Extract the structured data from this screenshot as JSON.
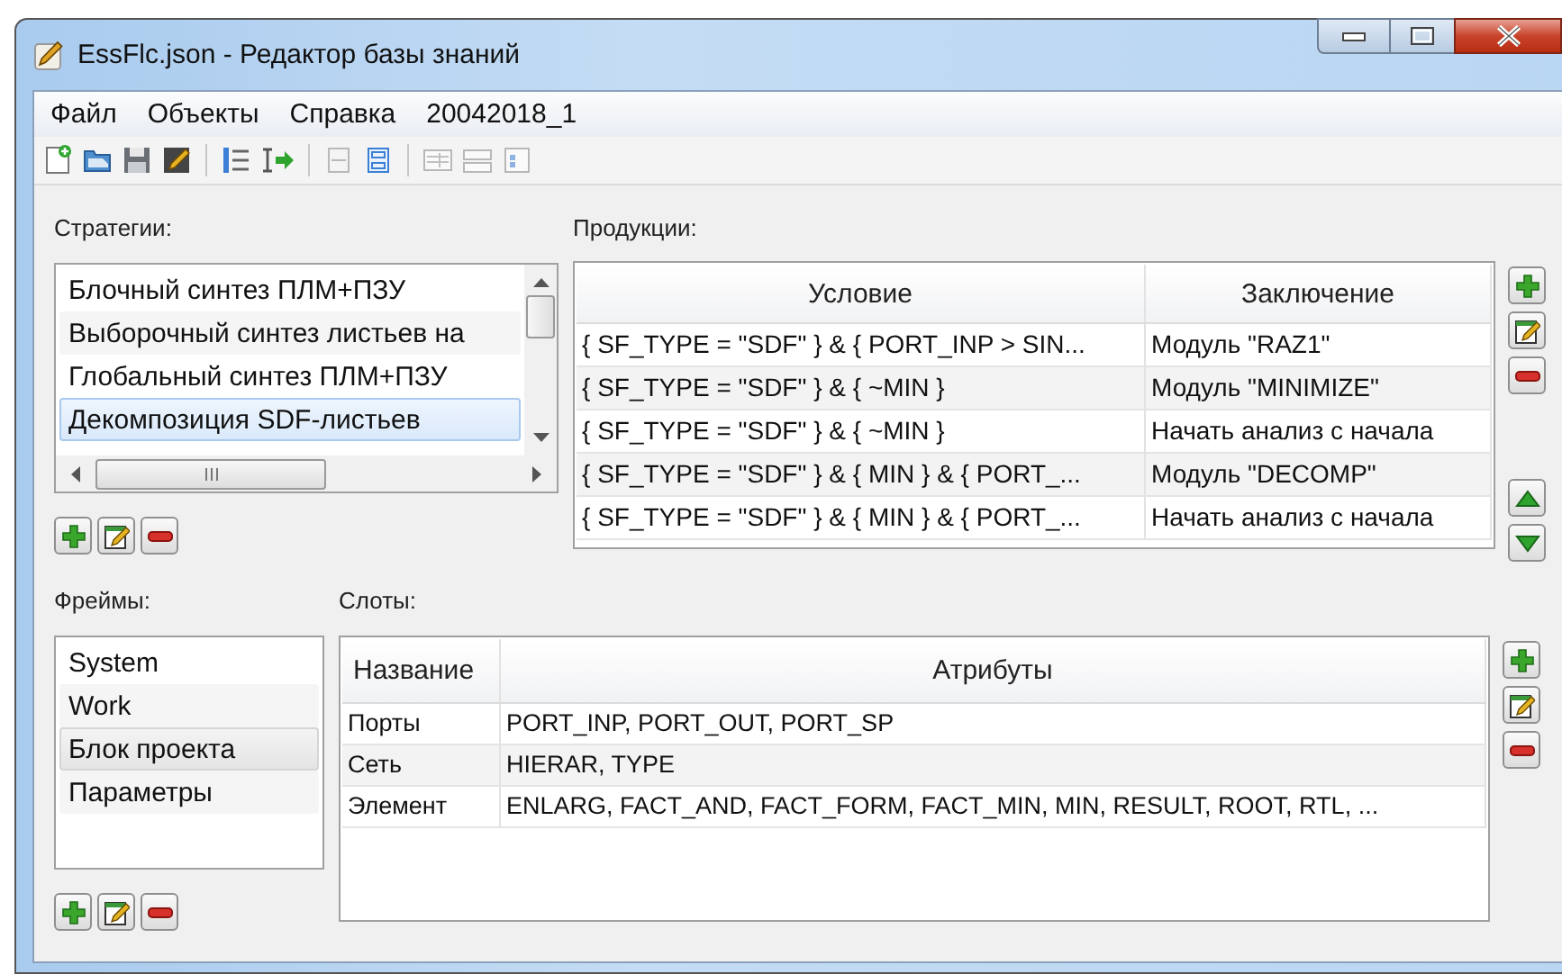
{
  "window": {
    "title": "EssFlc.json - Редактор базы знаний"
  },
  "menu": [
    "Файл",
    "Объекты",
    "Справка",
    "20042018_1"
  ],
  "toolbar": [
    {
      "disabled": false
    },
    {
      "disabled": false
    },
    {
      "disabled": false
    },
    {
      "disabled": false
    },
    {
      "disabled": false
    },
    {
      "disabled": false
    },
    {
      "disabled": true
    },
    {
      "disabled": false
    },
    {
      "disabled": true
    },
    {
      "disabled": true
    },
    {
      "disabled": true
    }
  ],
  "strategies": {
    "label": "Стратегии:",
    "items": [
      {
        "text": "Блочный синтез ПЛМ+ПЗУ",
        "selected": false
      },
      {
        "text": "Выборочный синтез листьев на",
        "selected": false
      },
      {
        "text": "Глобальный синтез ПЛМ+ПЗУ",
        "selected": false
      },
      {
        "text": "Декомпозиция SDF-листьев",
        "selected": true
      }
    ]
  },
  "productions": {
    "label": "Продукции:",
    "columns": [
      "Условие",
      "Заключение"
    ],
    "rows": [
      {
        "condition": "{ SF_TYPE = \"SDF\" } & { PORT_INP > SIN...",
        "conclusion": "Модуль \"RAZ1\""
      },
      {
        "condition": "{ SF_TYPE = \"SDF\" } & { ~MIN }",
        "conclusion": "Модуль \"MINIMIZE\""
      },
      {
        "condition": "{ SF_TYPE = \"SDF\" } & { ~MIN }",
        "conclusion": "Начать анализ с начала"
      },
      {
        "condition": "{ SF_TYPE = \"SDF\" } & { MIN } & { PORT_...",
        "conclusion": "Модуль \"DECOMP\""
      },
      {
        "condition": "{ SF_TYPE = \"SDF\" } & { MIN } & { PORT_...",
        "conclusion": "Начать анализ с начала"
      }
    ]
  },
  "frames": {
    "label": "Фреймы:",
    "items": [
      {
        "text": "System",
        "selected": false
      },
      {
        "text": "Work",
        "selected": false
      },
      {
        "text": "Блок проекта",
        "selected": true
      },
      {
        "text": "Параметры",
        "selected": false
      }
    ]
  },
  "slots": {
    "label": "Слоты:",
    "columns": [
      "Название",
      "Атрибуты"
    ],
    "rows": [
      {
        "name": "Порты",
        "attributes": "PORT_INP, PORT_OUT, PORT_SP"
      },
      {
        "name": "Сеть",
        "attributes": "HIERAR, TYPE"
      },
      {
        "name": "Элемент",
        "attributes": "ENLARG, FACT_AND, FACT_FORM, FACT_MIN, MIN, RESULT, ROOT, RTL, ..."
      }
    ]
  }
}
